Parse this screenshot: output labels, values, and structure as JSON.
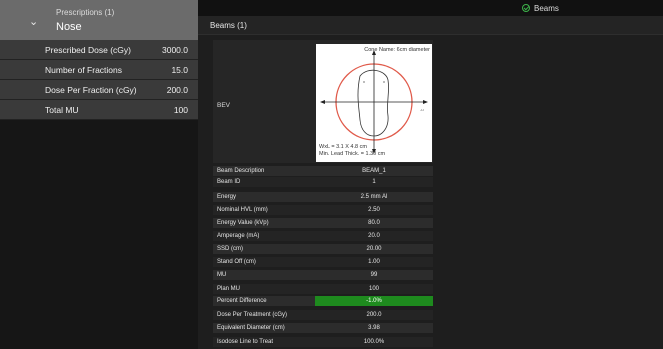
{
  "prescriptions": {
    "header_label": "Prescriptions (1)",
    "title": "Nose",
    "chevron_icon": "chevron-down-icon",
    "rows": [
      {
        "label": "Prescribed Dose (cGy)",
        "value": "3000.0"
      },
      {
        "label": "Number of Fractions",
        "value": "15.0"
      },
      {
        "label": "Dose Per Fraction (cGy)",
        "value": "200.0"
      },
      {
        "label": "Total MU",
        "value": "100"
      }
    ]
  },
  "top_tab": {
    "label": "Beams",
    "icon": "check-circle-icon",
    "icon_color": "#3db34a"
  },
  "beams": {
    "title": "Beams (1)",
    "bev": {
      "label": "BEV",
      "cone_name": "Cone Name: 6cm diameter",
      "wxl": "WxL = 3.1 X 4.8 cm",
      "lead": "Min. Lead Thick. = 1.30 cm"
    },
    "rows": [
      {
        "label": "Beam Description",
        "value": "BEAM_1"
      },
      {
        "label": "Beam ID",
        "value": "1"
      },
      {
        "label": "Energy",
        "value": "2.5 mm Al"
      },
      {
        "label": "Nominal HVL (mm)",
        "value": "2.50"
      },
      {
        "label": "Energy Value (kVp)",
        "value": "80.0"
      },
      {
        "label": "Amperage (mA)",
        "value": "20.0"
      },
      {
        "label": "SSD (cm)",
        "value": "20.00"
      },
      {
        "label": "Stand Off (cm)",
        "value": "1.00"
      },
      {
        "label": "MU",
        "value": "99"
      },
      {
        "label": "Plan MU",
        "value": "100"
      },
      {
        "label": "Percent Difference",
        "value": "-1.0%",
        "status": "pass"
      },
      {
        "label": "Dose Per Treatment (cGy)",
        "value": "200.0"
      },
      {
        "label": "Equivalent Diameter (cm)",
        "value": "3.98"
      },
      {
        "label": "Isodose Line to Treat",
        "value": "100.0%"
      }
    ],
    "pass_color": "#1e8a1e"
  }
}
